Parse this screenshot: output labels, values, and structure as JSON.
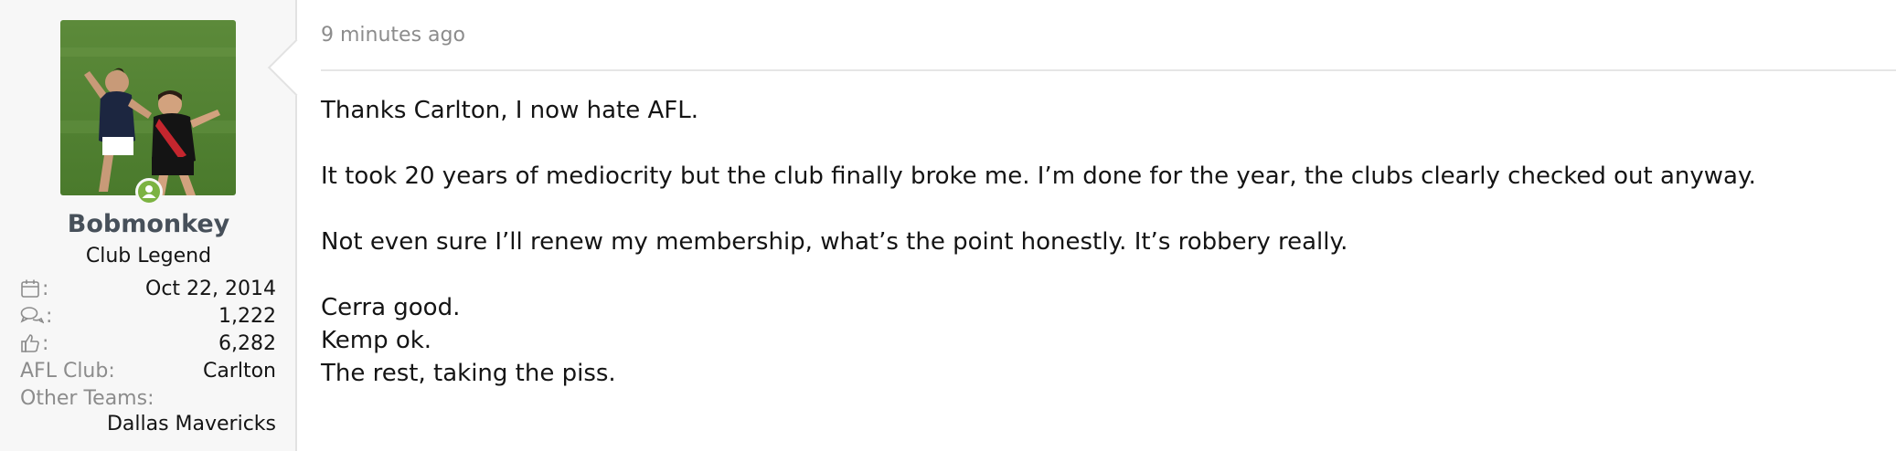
{
  "user": {
    "username": "Bobmonkey",
    "title": "Club Legend",
    "avatar_icon": "player-photo-avatar",
    "online_icon": "online-status-icon",
    "joined": "Oct 22, 2014",
    "messages": "1,222",
    "reactions": "6,282",
    "afl_club_label": "AFL Club:",
    "afl_club": "Carlton",
    "other_teams_label": "Other Teams:",
    "other_teams": "Dallas Mavericks",
    "colon": ":"
  },
  "post": {
    "timestamp": "9 minutes ago",
    "lines": [
      "Thanks Carlton, I now hate AFL.",
      "It took 20 years of mediocrity but the club finally broke me. I’m done for the year, the clubs clearly checked out anyway.",
      "Not even sure I’ll renew my membership, what’s the point honestly. It’s robbery really.",
      "Cerra good.",
      "Kemp ok.",
      "The rest, taking the piss."
    ]
  },
  "colors": {
    "sidebar_bg": "#f7f7f7",
    "username": "#47505a",
    "muted": "#8c8c8c",
    "online": "#7cb342"
  }
}
